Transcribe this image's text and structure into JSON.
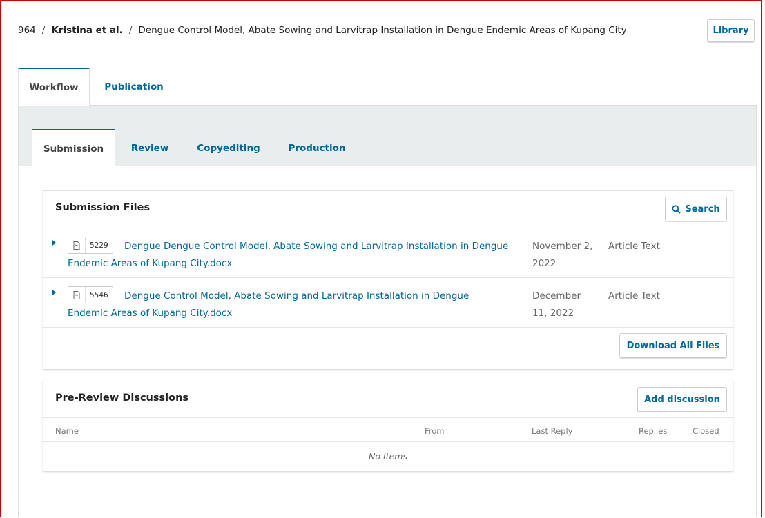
{
  "header": {
    "submission_id": "964",
    "author": "Kristina et al.",
    "title": "Dengue Control Model, Abate Sowing and Larvitrap Installation in Dengue Endemic Areas of Kupang City",
    "library_label": "Library"
  },
  "main_tabs": [
    {
      "label": "Workflow",
      "active": true
    },
    {
      "label": "Publication",
      "active": false
    }
  ],
  "stage_tabs": [
    {
      "label": "Submission",
      "active": true
    },
    {
      "label": "Review",
      "active": false
    },
    {
      "label": "Copyediting",
      "active": false
    },
    {
      "label": "Production",
      "active": false
    }
  ],
  "submission_files": {
    "title": "Submission Files",
    "search_label": "Search",
    "download_all_label": "Download All Files",
    "files": [
      {
        "id": "5229",
        "name": "Dengue Dengue Control Model, Abate Sowing and Larvitrap Installation in Dengue Endemic Areas of Kupang City.docx",
        "date": "November 2, 2022",
        "type": "Article Text"
      },
      {
        "id": "5546",
        "name": "Dengue Control Model, Abate Sowing and Larvitrap Installation in Dengue Endemic Areas of Kupang City.docx",
        "date": "December 11, 2022",
        "type": "Article Text"
      }
    ]
  },
  "discussions": {
    "title": "Pre-Review Discussions",
    "add_label": "Add discussion",
    "columns": {
      "name": "Name",
      "from": "From",
      "last_reply": "Last Reply",
      "replies": "Replies",
      "closed": "Closed"
    },
    "empty_text": "No Items"
  },
  "colors": {
    "accent": "#006798",
    "frame_border": "#d00000"
  }
}
